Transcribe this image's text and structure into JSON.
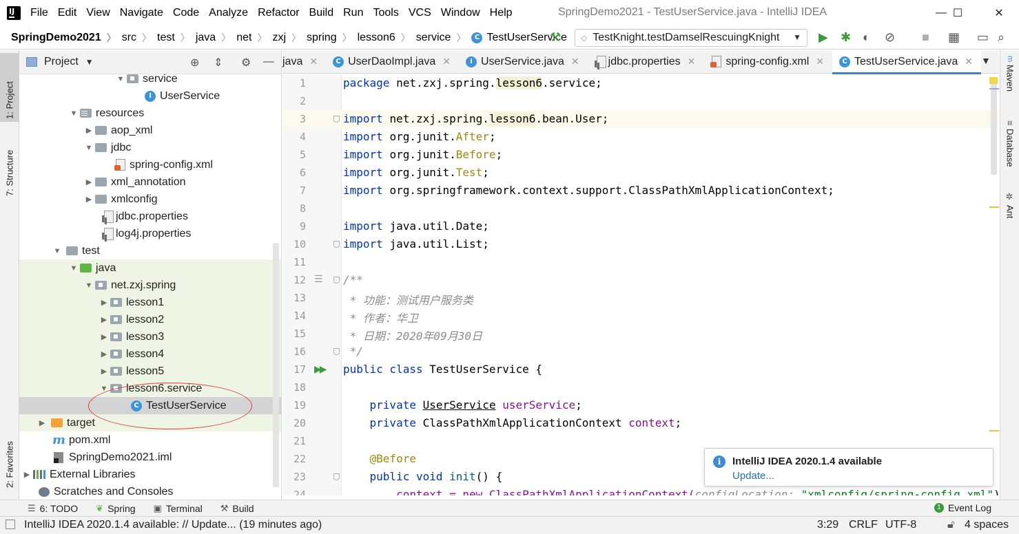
{
  "window": {
    "title": "SpringDemo2021 - TestUserService.java - IntelliJ IDEA",
    "minimize": "—",
    "maximize": "☐",
    "close": "✕"
  },
  "menu": [
    "File",
    "Edit",
    "View",
    "Navigate",
    "Code",
    "Analyze",
    "Refactor",
    "Build",
    "Run",
    "Tools",
    "VCS",
    "Window",
    "Help"
  ],
  "breadcrumbs": [
    "SpringDemo2021",
    "src",
    "test",
    "java",
    "net",
    "zxj",
    "spring",
    "lesson6",
    "service",
    "TestUserService"
  ],
  "run_config": {
    "label": "TestKnight.testDamselRescuingKnight"
  },
  "left_stripe": {
    "project": "1: Project",
    "structure": "7: Structure",
    "favorites": "2: Favorites"
  },
  "project_panel": {
    "title": "Project",
    "tree": [
      {
        "label": "service"
      },
      {
        "label": "UserService"
      },
      {
        "label": "resources"
      },
      {
        "label": "aop_xml"
      },
      {
        "label": "jdbc"
      },
      {
        "label": "spring-config.xml"
      },
      {
        "label": "xml_annotation"
      },
      {
        "label": "xmlconfig"
      },
      {
        "label": "jdbc.properties"
      },
      {
        "label": "log4j.properties"
      },
      {
        "label": "test"
      },
      {
        "label": "java"
      },
      {
        "label": "net.zxj.spring"
      },
      {
        "label": "lesson1"
      },
      {
        "label": "lesson2"
      },
      {
        "label": "lesson3"
      },
      {
        "label": "lesson4"
      },
      {
        "label": "lesson5"
      },
      {
        "label": "lesson6.service"
      },
      {
        "label": "TestUserService"
      },
      {
        "label": "target"
      },
      {
        "label": "pom.xml"
      },
      {
        "label": "SpringDemo2021.iml"
      },
      {
        "label": "External Libraries"
      },
      {
        "label": "Scratches and Consoles"
      }
    ]
  },
  "editor_tabs": [
    {
      "label": "java"
    },
    {
      "label": "UserDaoImpl.java"
    },
    {
      "label": "UserService.java"
    },
    {
      "label": "jdbc.properties"
    },
    {
      "label": "spring-config.xml"
    },
    {
      "label": "TestUserService.java"
    }
  ],
  "code": {
    "line_numbers": [
      "1",
      "2",
      "3",
      "4",
      "5",
      "6",
      "7",
      "8",
      "9",
      "10",
      "11",
      "12",
      "13",
      "14",
      "15",
      "16",
      "17",
      "18",
      "19",
      "20",
      "21",
      "22",
      "23",
      "24"
    ],
    "l1_kw": "package",
    "l1_a": "net.zxj.spring.",
    "l1_b": "lesson6",
    "l1_c": ".service;",
    "l3_kw": "import",
    "l3_a": "net.zxj.spring.",
    "l3_b": "lesson6",
    "l3_c": ".bean.User;",
    "l4_kw": "import",
    "l4_a": "org.junit.",
    "l4_b": "After",
    "l4_c": ";",
    "l5_kw": "import",
    "l5_a": "org.junit.",
    "l5_b": "Before",
    "l5_c": ";",
    "l6_kw": "import",
    "l6_a": "org.junit.",
    "l6_b": "Test",
    "l6_c": ";",
    "l7_kw": "import",
    "l7_a": "org.springframework.context.support.ClassPathXmlApplicationContext;",
    "l9_kw": "import",
    "l9_a": "java.util.Date;",
    "l10_kw": "import",
    "l10_a": "java.util.List;",
    "l12": "/**",
    "l13": " * 功能：测试用户服务类",
    "l14": " * 作者：华卫",
    "l15": " * 日期：2020年09月30日",
    "l16": " */",
    "l17_kw": "public class",
    "l17_a": "TestUserService {",
    "l19_kw": "private",
    "l19_type": "UserService",
    "l19_fld": "userService",
    "l19_end": ";",
    "l20_kw": "private",
    "l20_type": "ClassPathXmlApplicationContext",
    "l20_fld": "context",
    "l20_end": ";",
    "l22": "@Before",
    "l23_kw": "public void",
    "l23_fn": "init",
    "l23_end": "() {",
    "l24_a": "context = new ClassPathXmlApplicationContext(",
    "l24_b": "configLocation: ",
    "l24_c": "\"xmlconfig/spring-config.xml\"",
    "l24_d": ");"
  },
  "right_stripe": {
    "maven": "Maven",
    "database": "Database",
    "ant": "Ant"
  },
  "notification": {
    "title": "IntelliJ IDEA 2020.1.4 available",
    "link": "Update..."
  },
  "bottom_tools": {
    "todo": "6: TODO",
    "spring": "Spring",
    "terminal": "Terminal",
    "build": "Build",
    "event_log": "Event Log",
    "event_count": "1"
  },
  "status": {
    "message": "IntelliJ IDEA 2020.1.4 available: // Update... (19 minutes ago)",
    "position": "3:29",
    "line_sep": "CRLF",
    "encoding": "UTF-8",
    "indent": "4 spaces"
  }
}
